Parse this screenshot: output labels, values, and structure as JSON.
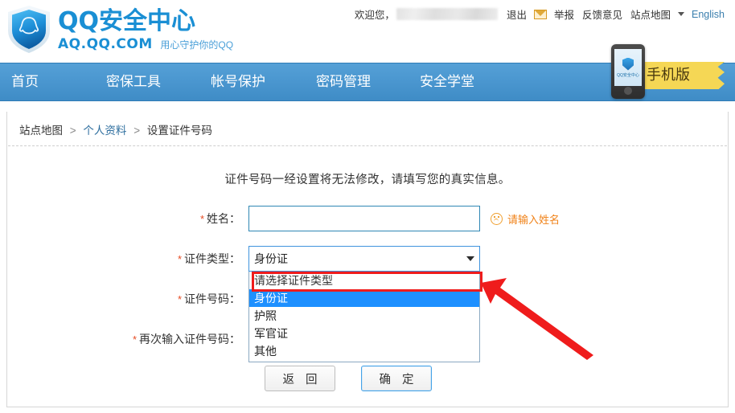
{
  "header": {
    "logo_title": "QQ安全中心",
    "logo_domain": "AQ.QQ.COM",
    "logo_slogan": "用心守护你的QQ",
    "welcome": "欢迎您，",
    "logout": "退出",
    "mail_icon": "envelope-icon",
    "report": "举报",
    "feedback": "反馈意见",
    "sitemap": "站点地图",
    "english": "English"
  },
  "nav": {
    "items": [
      {
        "label": "首页"
      },
      {
        "label": "密保工具"
      },
      {
        "label": "帐号保护"
      },
      {
        "label": "密码管理"
      },
      {
        "label": "安全学堂"
      }
    ],
    "mobile_ribbon": "手机版",
    "phone_label": "QQ安全中心"
  },
  "breadcrumb": {
    "root": "站点地图",
    "parent": "个人资料",
    "current": "设置证件号码",
    "separator": ">"
  },
  "main": {
    "notice": "证件号码一经设置将无法修改，请填写您的真实信息。",
    "fields": {
      "name": {
        "label": "姓名：",
        "required": "*",
        "value": "",
        "placeholder": "",
        "error": "请输入姓名"
      },
      "id_type": {
        "label": "证件类型：",
        "required": "*",
        "selected": "身份证",
        "options": [
          {
            "label": "请选择证件类型",
            "state": "placeholder"
          },
          {
            "label": "身份证",
            "state": "selected"
          },
          {
            "label": "护照",
            "state": "normal"
          },
          {
            "label": "军官证",
            "state": "normal"
          },
          {
            "label": "其他",
            "state": "normal"
          }
        ]
      },
      "id_number": {
        "label": "证件号码：",
        "required": "*",
        "value": "",
        "placeholder": ""
      },
      "id_number_confirm": {
        "label": "再次输入证件号码：",
        "required": "*",
        "value": "",
        "placeholder": ""
      }
    },
    "buttons": {
      "back": "返 回",
      "confirm": "确 定"
    }
  },
  "annotations": {
    "highlight_color": "#ef1c1c",
    "arrow_color": "#ef1c1c",
    "highlight_target": "身份证"
  },
  "colors": {
    "brand_blue": "#1a8fd4",
    "nav_blue": "#4b97d0",
    "error_orange": "#f08218",
    "required_red": "#e64b22",
    "link_blue": "#2f6f9f",
    "option_highlight": "#1e90ff"
  }
}
